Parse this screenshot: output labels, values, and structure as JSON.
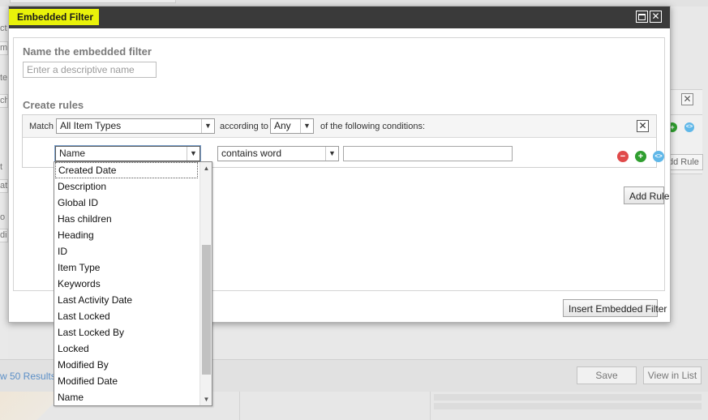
{
  "dialog": {
    "title": "Embedded Filter",
    "close_symbol": "✕"
  },
  "name_section": {
    "label": "Name the embedded filter",
    "placeholder": "Enter a descriptive name"
  },
  "rules_section": {
    "label": "Create rules",
    "match_label": "Match",
    "item_type_value": "All Item Types",
    "according_label": "according to",
    "any_value": "Any",
    "conditions_label": "of the following conditions:",
    "rule": {
      "field_value": "Name",
      "operator_value": "contains word",
      "value_text": ""
    }
  },
  "buttons": {
    "add_rule": "Add Rule",
    "insert": "Insert Embedded Filter"
  },
  "dropdown": {
    "options": [
      "Created Date",
      "Description",
      "Global ID",
      "Has children",
      "Heading",
      "ID",
      "Item Type",
      "Keywords",
      "Last Activity Date",
      "Last Locked",
      "Last Locked By",
      "Locked",
      "Modified By",
      "Modified Date",
      "Name"
    ],
    "scroll_up": "▲",
    "scroll_down": "▼"
  },
  "background": {
    "results_link": "w 50 Results...",
    "save_button": "Save",
    "view_in_list_button": "View in List",
    "add_rule_fragment": "dd Rule",
    "left_fragments": [
      "ct",
      "m",
      "te",
      "ch",
      "t",
      "at",
      "o",
      "di"
    ]
  },
  "colors": {
    "titlebar": "#3a3a3a",
    "title_highlight": "#e9f20a",
    "remove_icon": "#e04a4a",
    "add_icon": "#2f9e2f",
    "group_icon": "#5fb7e8"
  },
  "icons": {
    "remove": "remove-rule-icon",
    "add": "add-rule-icon",
    "group": "group-rule-icon",
    "minimize": "minimize-icon",
    "close": "close-icon"
  }
}
